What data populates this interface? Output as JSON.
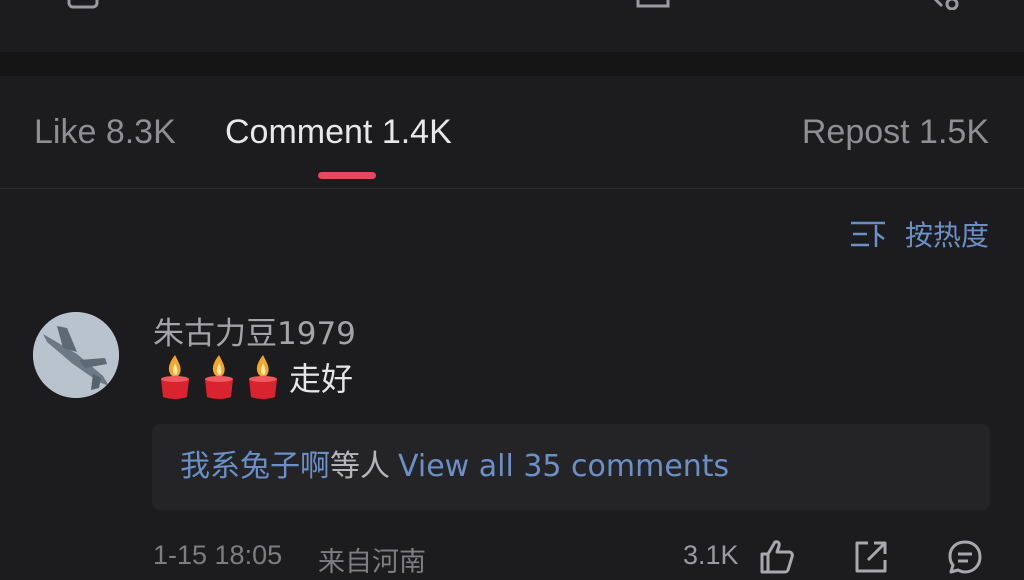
{
  "top_toolbar": {
    "icons": [
      "box-icon",
      "edit-icon",
      "image-icon",
      "share-icon"
    ]
  },
  "tabs": [
    {
      "label": "Like 8.3K",
      "active": false
    },
    {
      "label": "Comment 1.4K",
      "active": true
    },
    {
      "label": "Repost 1.5K",
      "active": false
    }
  ],
  "accent_color": "#e8475f",
  "link_color": "#6b8fc7",
  "sort": {
    "label": "按热度",
    "icon": "sort-icon"
  },
  "comment": {
    "username": "朱古力豆1979",
    "avatar_icon": "jet-avatar-icon",
    "emoji_count": 3,
    "emoji": "candle-icon",
    "text": "走好",
    "replies": {
      "replier": "我系兔子啊",
      "others": "等人",
      "view_all": "View all 35 comments"
    },
    "time": "1-15 18:05",
    "location": "来自河南",
    "like_count": "3.1K"
  }
}
